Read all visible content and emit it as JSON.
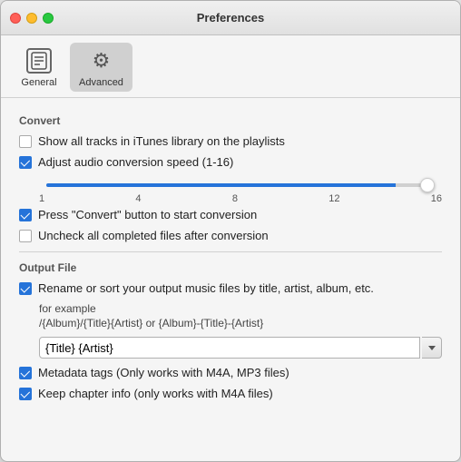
{
  "window": {
    "title": "Preferences"
  },
  "toolbar": {
    "items": [
      {
        "id": "general",
        "label": "General",
        "active": false
      },
      {
        "id": "advanced",
        "label": "Advanced",
        "active": true
      }
    ]
  },
  "convert_section": {
    "title": "Convert",
    "options": [
      {
        "id": "show_all_tracks",
        "checked": false,
        "label": "Show all tracks in iTunes library on the playlists"
      },
      {
        "id": "adjust_audio",
        "checked": true,
        "label": "Adjust audio conversion speed (1-16)"
      },
      {
        "id": "press_convert",
        "checked": true,
        "label": "Press \"Convert\" button to start conversion"
      },
      {
        "id": "uncheck_completed",
        "checked": false,
        "label": "Uncheck all completed files after conversion"
      }
    ],
    "slider": {
      "min": 1,
      "max": 16,
      "value": 16,
      "labels": [
        "1",
        "4",
        "8",
        "12",
        "16"
      ]
    }
  },
  "output_section": {
    "title": "Output File",
    "rename_option": {
      "checked": true,
      "label": "Rename or sort your output music files by title, artist, album, etc."
    },
    "example_label": "for example",
    "example_path": "/{Album}/{Title}{Artist} or {Album}-{Title}-{Artist}",
    "input_value": "{Title} {Artist}",
    "metadata_option": {
      "checked": true,
      "label": "Metadata tags (Only works with M4A, MP3 files)"
    },
    "chapter_option": {
      "checked": true,
      "label": "Keep chapter info (only works with  M4A files)"
    }
  }
}
